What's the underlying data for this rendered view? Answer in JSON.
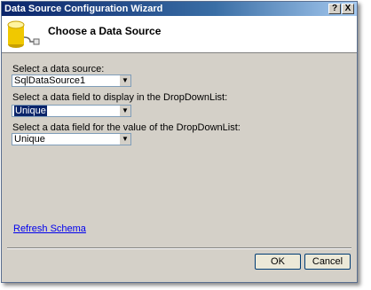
{
  "window": {
    "title": "Data Source Configuration Wizard",
    "help_label": "?",
    "close_label": "X"
  },
  "header": {
    "title": "Choose a Data Source"
  },
  "fields": [
    {
      "label": "Select a data source:",
      "value": "SqlDataSource1"
    },
    {
      "label": "Select a data field to display in the DropDownList:",
      "value": "Unique"
    },
    {
      "label": "Select a data field for the value of the DropDownList:",
      "value": "Unique"
    }
  ],
  "refresh_link": "Refresh Schema",
  "buttons": {
    "ok": "OK",
    "cancel": "Cancel"
  },
  "colors": {
    "titlebar_start": "#0a246a",
    "dialog_bg": "#d4d0c8",
    "link": "#0000ee",
    "selection": "#0a246a"
  }
}
